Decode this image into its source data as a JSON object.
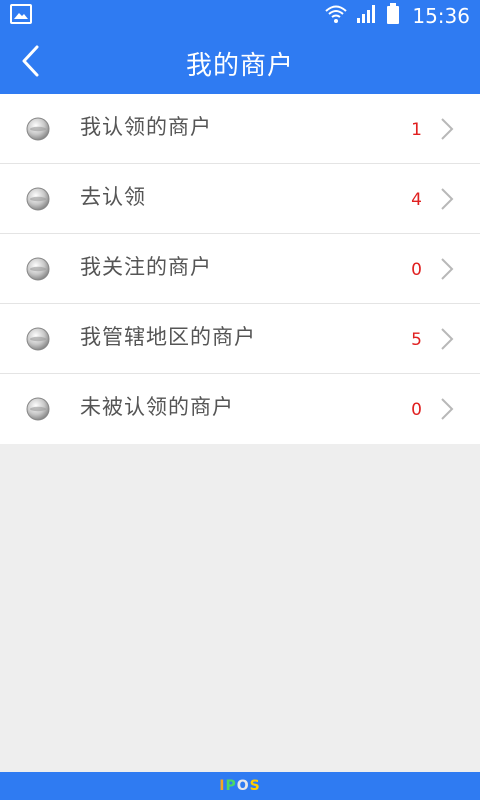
{
  "status_bar": {
    "time": "15:36",
    "icons": [
      "gallery-icon",
      "wifi-icon",
      "signal-icon",
      "battery-icon"
    ]
  },
  "header": {
    "title": "我的商户",
    "back_icon": "chevron-left-icon"
  },
  "list": {
    "items": [
      {
        "label": "我认领的商户",
        "count": "1"
      },
      {
        "label": "去认领",
        "count": "4"
      },
      {
        "label": "我关注的商户",
        "count": "0"
      },
      {
        "label": "我管辖地区的商户",
        "count": "5"
      },
      {
        "label": "未被认领的商户",
        "count": "0"
      }
    ]
  },
  "footer": {
    "logo_letters": [
      "I",
      "P",
      "O",
      "S"
    ]
  },
  "colors": {
    "primary": "#2f7bf2",
    "count": "#e02020",
    "background": "#eeeeee"
  }
}
